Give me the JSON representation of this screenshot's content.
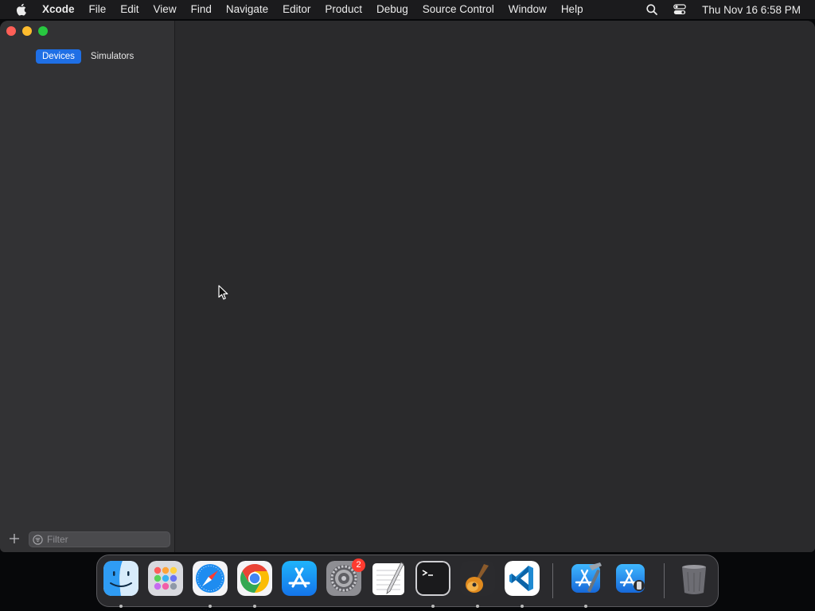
{
  "menubar": {
    "apple_icon": "apple-logo-icon",
    "app_name": "Xcode",
    "items": [
      "File",
      "Edit",
      "View",
      "Find",
      "Navigate",
      "Editor",
      "Product",
      "Debug",
      "Source Control",
      "Window",
      "Help"
    ],
    "status_icons": [
      "search-icon",
      "control-center-icon"
    ],
    "clock": "Thu Nov 16  6:58 PM"
  },
  "window": {
    "tabs": [
      {
        "label": "Devices",
        "selected": true
      },
      {
        "label": "Simulators",
        "selected": false
      }
    ],
    "filter": {
      "placeholder": "Filter",
      "value": ""
    },
    "add_icon": "plus-icon"
  },
  "dock": {
    "apps": [
      {
        "name": "Finder",
        "icon": "finder-icon",
        "running": true
      },
      {
        "name": "Launchpad",
        "icon": "launchpad-icon",
        "running": false
      },
      {
        "name": "Safari",
        "icon": "safari-icon",
        "running": true
      },
      {
        "name": "Google Chrome",
        "icon": "chrome-icon",
        "running": true
      },
      {
        "name": "App Store",
        "icon": "app-store-icon",
        "running": false
      },
      {
        "name": "System Settings",
        "icon": "system-settings-icon",
        "running": false,
        "badge": "2"
      },
      {
        "name": "TextEdit",
        "icon": "textedit-icon",
        "running": false
      },
      {
        "name": "Terminal",
        "icon": "terminal-icon",
        "running": true
      },
      {
        "name": "GarageBand",
        "icon": "garageband-icon",
        "running": true
      },
      {
        "name": "Visual Studio Code",
        "icon": "vscode-icon",
        "running": true
      },
      {
        "name": "Xcode",
        "icon": "xcode-icon",
        "running": true
      },
      {
        "name": "Simulator",
        "icon": "simulator-icon",
        "running": false
      },
      {
        "name": "Trash",
        "icon": "trash-icon",
        "running": false
      }
    ]
  },
  "colors": {
    "accent": "#1f6fe5",
    "close": "#ff5f57",
    "minimize": "#febc2e",
    "maximize": "#28c840",
    "badge": "#ff3b30"
  }
}
